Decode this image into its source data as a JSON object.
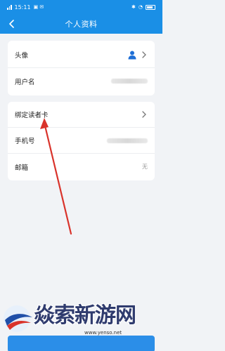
{
  "status_bar": {
    "time": "15:11"
  },
  "header": {
    "title": "个人资料"
  },
  "profile_card": {
    "rows": [
      {
        "label": "头像"
      },
      {
        "label": "用户名"
      }
    ]
  },
  "account_card": {
    "rows": [
      {
        "label": "绑定读者卡"
      },
      {
        "label": "手机号"
      },
      {
        "label": "邮箱",
        "value": "无"
      }
    ]
  },
  "watermark": {
    "brand": "焱索新游网",
    "url": "www.yenso.net"
  },
  "colors": {
    "primary": "#1a8fe6",
    "background": "#f1f3f6",
    "arrow": "#d9332b"
  }
}
